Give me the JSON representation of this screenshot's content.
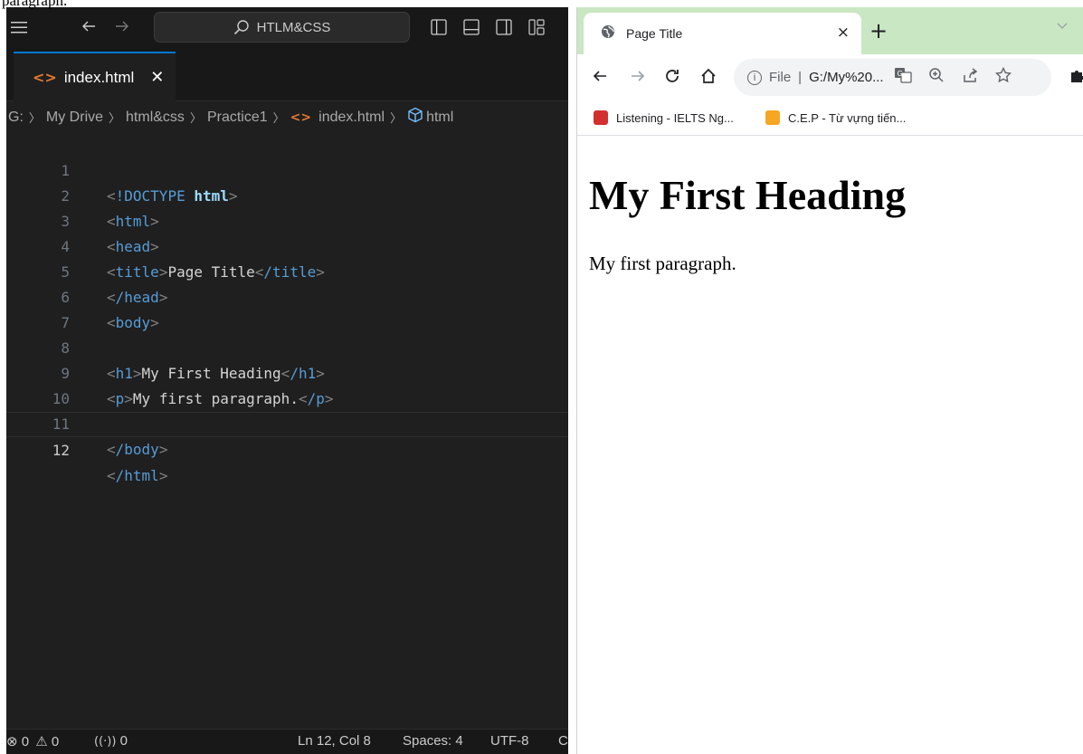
{
  "doc_fragment": "paragraph.",
  "vscode": {
    "search_label": "HTLM&CSS",
    "tab": {
      "name": "index.html",
      "close": "✕"
    },
    "breadcrumb": [
      "G:",
      "My Drive",
      "html&css",
      "Practice1",
      "index.html",
      "html"
    ],
    "lines": [
      {
        "n": "1"
      },
      {
        "n": "2"
      },
      {
        "n": "3"
      },
      {
        "n": "4"
      },
      {
        "n": "5"
      },
      {
        "n": "6"
      },
      {
        "n": "7"
      },
      {
        "n": "8"
      },
      {
        "n": "9"
      },
      {
        "n": "10"
      },
      {
        "n": "11"
      },
      {
        "n": "12"
      }
    ],
    "code": {
      "l1_doctype": "!DOCTYPE",
      "l1_html": "html",
      "l2_tag": "html",
      "l3_tag": "head",
      "l4_tag": "title",
      "l4_text": "Page Title",
      "l5_tag": "/head",
      "l6_tag": "body",
      "l8_tag": "h1",
      "l8_text": "My First Heading",
      "l8_close": "/h1",
      "l9_tag": "p",
      "l9_text": "My first paragraph.",
      "l9_close": "/p",
      "l11_tag": "/body",
      "l12_tag": "/html",
      "l4_close": "/title"
    },
    "status": {
      "errors": "0",
      "warnings": "0",
      "ports": "0",
      "position": "Ln 12, Col 8",
      "spaces": "Spaces: 4",
      "encoding": "UTF-8",
      "eol": "CI"
    }
  },
  "chrome": {
    "tab_title": "Page Title",
    "tab_close": "×",
    "new_tab": "+",
    "omnibox": {
      "scheme": "File",
      "url": "G:/My%20..."
    },
    "bookmarks": [
      {
        "label": "Listening - IELTS Ng...",
        "color": "#d32f2f"
      },
      {
        "label": "C.E.P - Từ vựng tiến...",
        "color": "#f5a623"
      }
    ],
    "page": {
      "heading": "My First Heading",
      "paragraph": "My first paragraph."
    }
  },
  "colors": {
    "vscode_bg": "#1f1f1f",
    "accent": "#0078d4",
    "chrome_tabstrip": "#c9e7c2"
  }
}
